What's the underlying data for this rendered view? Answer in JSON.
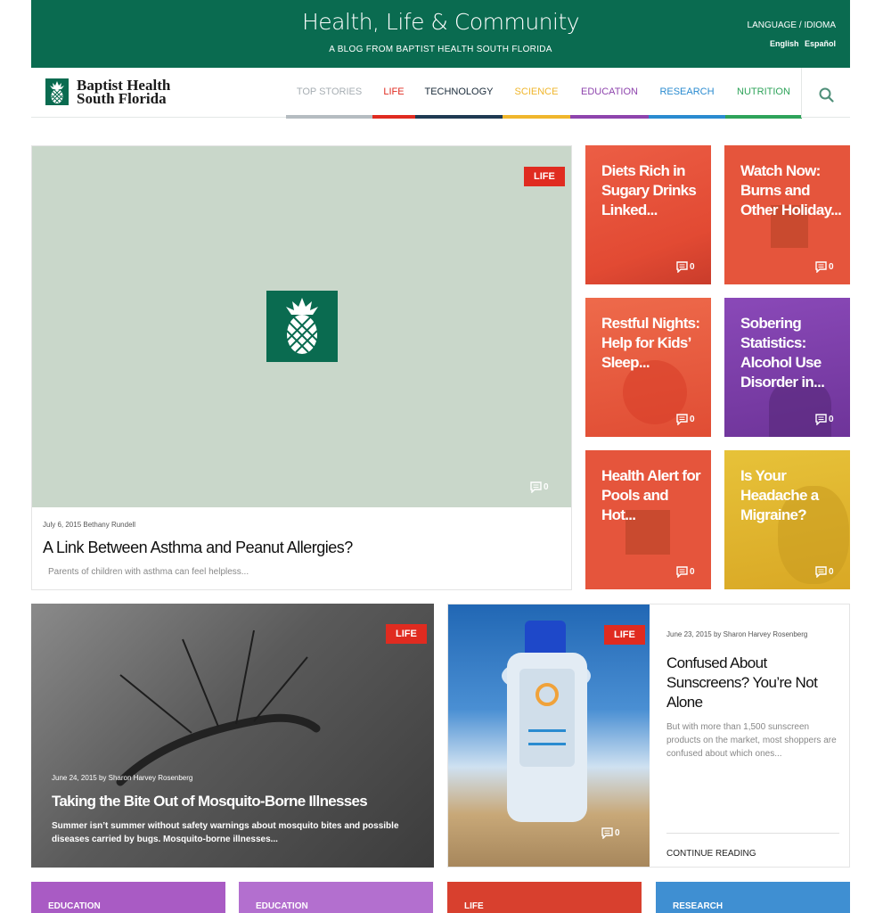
{
  "banner": {
    "title": "Health, Life & Community",
    "subtitle": "A BLOG FROM BAPTIST HEALTH SOUTH FLORIDA",
    "language_label": "LANGUAGE / IDIOMA",
    "languages": [
      "English",
      "Español"
    ]
  },
  "logo": {
    "line1": "Baptist Health",
    "line2": "South Florida"
  },
  "nav": {
    "items": [
      {
        "label": "TOP STORIES",
        "color": "#9aa3ab"
      },
      {
        "label": "LIFE",
        "color": "#e02b20"
      },
      {
        "label": "TECHNOLOGY",
        "color": "#1f3a52"
      },
      {
        "label": "SCIENCE",
        "color": "#f0b62c"
      },
      {
        "label": "EDUCATION",
        "color": "#8e44ad"
      },
      {
        "label": "RESEARCH",
        "color": "#2a8bd0"
      },
      {
        "label": "NUTRITION",
        "color": "#2ea35a"
      }
    ],
    "search_icon": "search-icon"
  },
  "hero": {
    "badge": "LIFE",
    "comments": "0",
    "date": "July 6, 2015",
    "author": "Bethany Rundell",
    "title": "A Link Between Asthma and Peanut Allergies?",
    "excerpt": "Parents of children with asthma can feel helpless..."
  },
  "tiles": [
    {
      "title": "Diets Rich in Sugary Drinks Linked...",
      "comments": "0",
      "color": "#e8553c"
    },
    {
      "title": "Watch Now: Burns and Other Holiday...",
      "comments": "0",
      "color": "#e8553c"
    },
    {
      "title": "Restful Nights: Help for Kids’ Sleep...",
      "comments": "0",
      "color": "#e8553c"
    },
    {
      "title": "Sobering Statistics: Alcohol Use Disorder in...",
      "comments": "0",
      "color": "#7b3fa8"
    },
    {
      "title": "Health Alert for Pools and Hot...",
      "comments": "0",
      "color": "#e8553c"
    },
    {
      "title": "Is Your Headache a Migraine?",
      "comments": "0",
      "color": "#e0b52c"
    }
  ],
  "wide": {
    "badge": "LIFE",
    "date": "June 24, 2015",
    "author": "Sharon Harvey Rosenberg",
    "title": "Taking the Bite Out of Mosquito-Borne Illnesses",
    "excerpt": "Summer isn’t summer without safety warnings about mosquito bites and possible diseases carried by bugs. Mosquito-borne illnesses..."
  },
  "split": {
    "badge": "LIFE",
    "comments": "0",
    "date": "June 23, 2015",
    "author": "Sharon Harvey Rosenberg",
    "title": "Confused About Sunscreens? You’re Not Alone",
    "excerpt": "But with more than 1,500 sunscreen products on the market, most shoppers are confused about which ones...",
    "cta": "CONTINUE READING"
  },
  "strip": [
    {
      "label": "EDUCATION",
      "color": "#a95bc4"
    },
    {
      "label": "EDUCATION",
      "color": "#b36fcf"
    },
    {
      "label": "LIFE",
      "color": "#d8402e"
    },
    {
      "label": "RESEARCH",
      "color": "#3f8fd2"
    }
  ],
  "by_word": "by"
}
